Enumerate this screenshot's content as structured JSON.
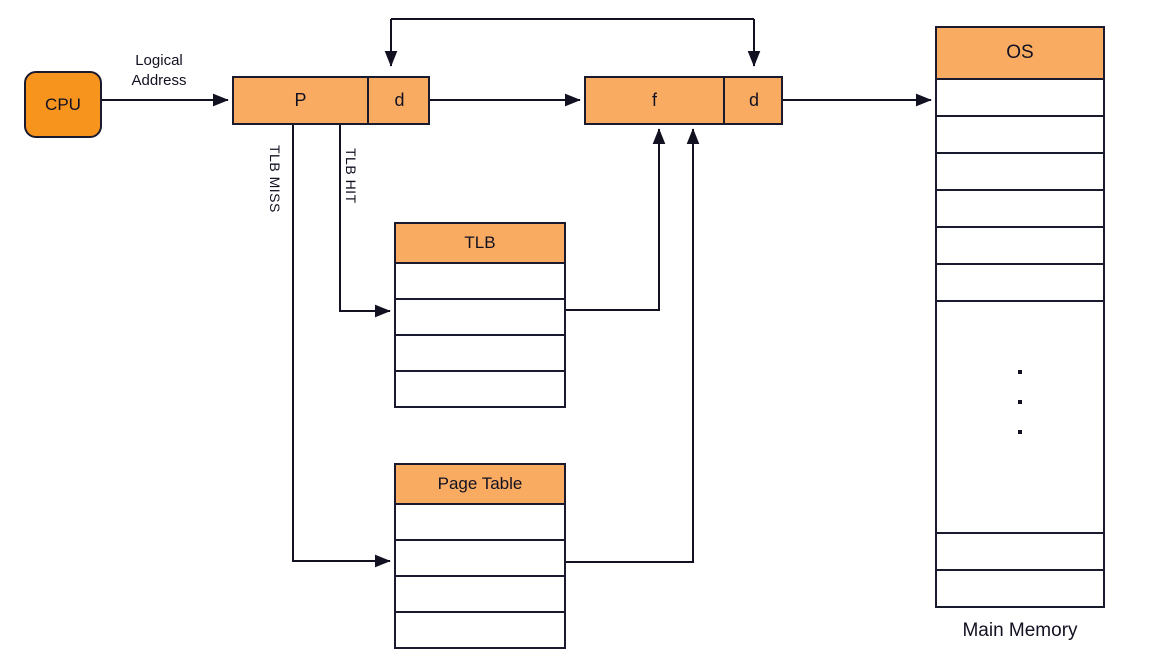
{
  "diagram": {
    "title_label": "Main Memory",
    "cpu": {
      "label": "CPU"
    },
    "logical_address": {
      "arrow_label": "Logical\nAddress",
      "page_cell": "P",
      "offset_cell": "d"
    },
    "physical_address": {
      "frame_cell": "f",
      "offset_cell": "d"
    },
    "paths": {
      "tlb_miss": "TLB MISS",
      "tlb_hit": "TLB HIT"
    },
    "tlb": {
      "header": "TLB",
      "rows": [
        "",
        "",
        "",
        ""
      ]
    },
    "page_table": {
      "header": "Page Table",
      "rows": [
        "",
        "",
        "",
        ""
      ]
    },
    "main_memory": {
      "header": "OS",
      "rows": [
        "",
        "",
        "",
        "",
        "",
        ""
      ],
      "ellipsis": [
        "·",
        "·",
        "·"
      ],
      "bottom_rows": [
        "",
        ""
      ],
      "caption": "Main Memory"
    },
    "colors": {
      "cpu_fill": "#f7941e",
      "box_fill": "#f9ab62",
      "stroke": "#1a1a2e",
      "background": "#ffffff"
    }
  }
}
